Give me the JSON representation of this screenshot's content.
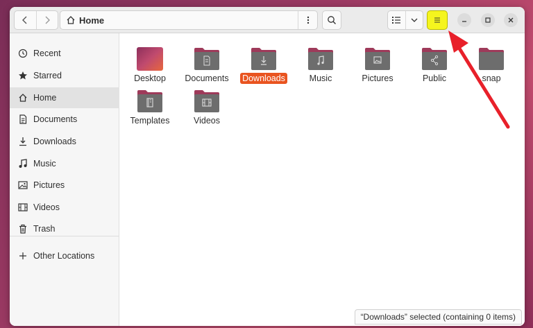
{
  "header": {
    "location": "Home",
    "back_icon": "chevron-left-icon",
    "forward_icon": "chevron-right-icon",
    "search_icon": "search-icon",
    "menu_icon": "hamburger-menu-icon",
    "menu_highlight": "#f5f51e"
  },
  "sidebar": {
    "items": [
      {
        "label": "Recent",
        "icon": "clock-icon"
      },
      {
        "label": "Starred",
        "icon": "star-icon"
      },
      {
        "label": "Home",
        "icon": "home-icon",
        "active": true
      },
      {
        "label": "Documents",
        "icon": "document-icon"
      },
      {
        "label": "Downloads",
        "icon": "download-icon"
      },
      {
        "label": "Music",
        "icon": "music-note-icon"
      },
      {
        "label": "Pictures",
        "icon": "picture-icon"
      },
      {
        "label": "Videos",
        "icon": "film-icon"
      },
      {
        "label": "Trash",
        "icon": "trash-icon"
      }
    ],
    "other": {
      "label": "Other Locations",
      "icon": "plus-icon"
    }
  },
  "files": [
    {
      "name": "Desktop",
      "icon": "desktop-folder-icon"
    },
    {
      "name": "Documents",
      "icon": "documents-folder-icon"
    },
    {
      "name": "Downloads",
      "icon": "downloads-folder-icon",
      "selected": true
    },
    {
      "name": "Music",
      "icon": "music-folder-icon"
    },
    {
      "name": "Pictures",
      "icon": "pictures-folder-icon"
    },
    {
      "name": "Public",
      "icon": "public-folder-icon"
    },
    {
      "name": "snap",
      "icon": "folder-icon"
    },
    {
      "name": "Templates",
      "icon": "templates-folder-icon"
    },
    {
      "name": "Videos",
      "icon": "videos-folder-icon"
    }
  ],
  "status": "“Downloads” selected  (containing 0 items)",
  "colors": {
    "accent": "#e95420",
    "folder": "#6d6d6d",
    "folder_tab": "#9e3a5a",
    "annotation_arrow": "#e8202a"
  }
}
